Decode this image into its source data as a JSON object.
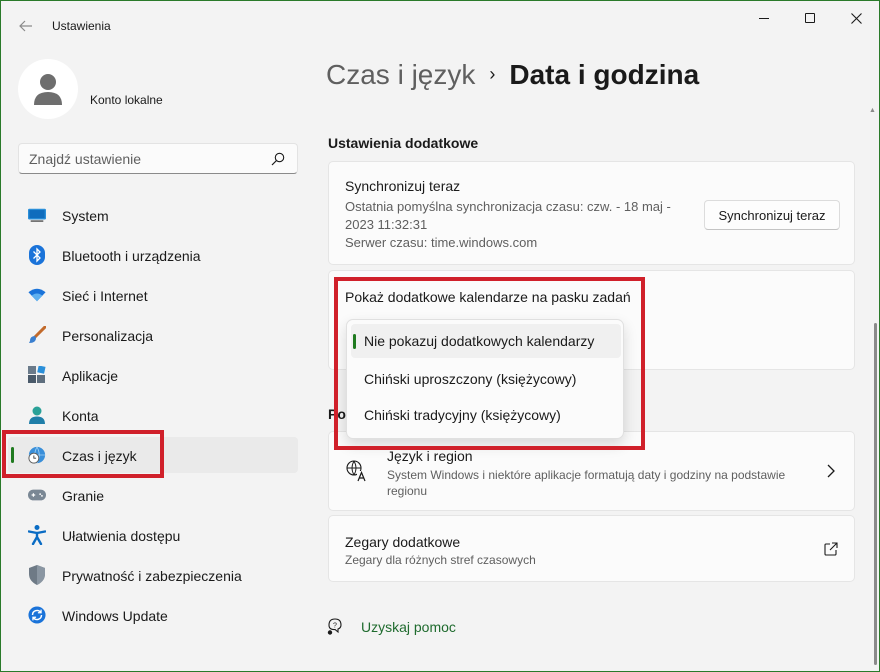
{
  "window": {
    "title": "Ustawienia",
    "accent": "#1f7a1f",
    "highlight_color": "#d0202a"
  },
  "sidebar": {
    "profile_name": "Konto lokalne",
    "search_placeholder": "Znajdź ustawienie",
    "items": [
      {
        "label": "System",
        "icon": "monitor-icon"
      },
      {
        "label": "Bluetooth i urządzenia",
        "icon": "bluetooth-icon"
      },
      {
        "label": "Sieć i Internet",
        "icon": "wifi-icon"
      },
      {
        "label": "Personalizacja",
        "icon": "brush-icon"
      },
      {
        "label": "Aplikacje",
        "icon": "apps-icon"
      },
      {
        "label": "Konta",
        "icon": "person-icon"
      },
      {
        "label": "Czas i język",
        "icon": "globe-clock-icon",
        "active": true
      },
      {
        "label": "Granie",
        "icon": "gamepad-icon"
      },
      {
        "label": "Ułatwienia dostępu",
        "icon": "accessibility-icon"
      },
      {
        "label": "Prywatność i zabezpieczenia",
        "icon": "shield-icon"
      },
      {
        "label": "Windows Update",
        "icon": "update-icon"
      }
    ]
  },
  "breadcrumb": {
    "parent": "Czas i język",
    "separator": "›",
    "current": "Data i godzina"
  },
  "main": {
    "section_title": "Ustawienia dodatkowe",
    "sync": {
      "title": "Synchronizuj teraz",
      "description": "Ostatnia pomyślna synchronizacja czasu: czw. - 18 maj - 2023 11:32:31",
      "server": "Serwer czasu: time.windows.com",
      "button": "Synchronizuj teraz"
    },
    "calendars": {
      "title": "Pokaż dodatkowe kalendarze na pasku zadań",
      "options": [
        "Nie pokazuj dodatkowych kalendarzy",
        "Chiński uproszczony (księżycowy)",
        "Chiński tradycyjny (księżycowy)"
      ],
      "selected_index": 0
    },
    "related_title": "Po",
    "language_region": {
      "title": "Język i region",
      "description": "System Windows i niektóre aplikacje formatują daty i godziny na podstawie regionu"
    },
    "extra_clocks": {
      "title": "Zegary dodatkowe",
      "description": "Zegary dla różnych stref czasowych"
    },
    "help": "Uzyskaj pomoc"
  }
}
